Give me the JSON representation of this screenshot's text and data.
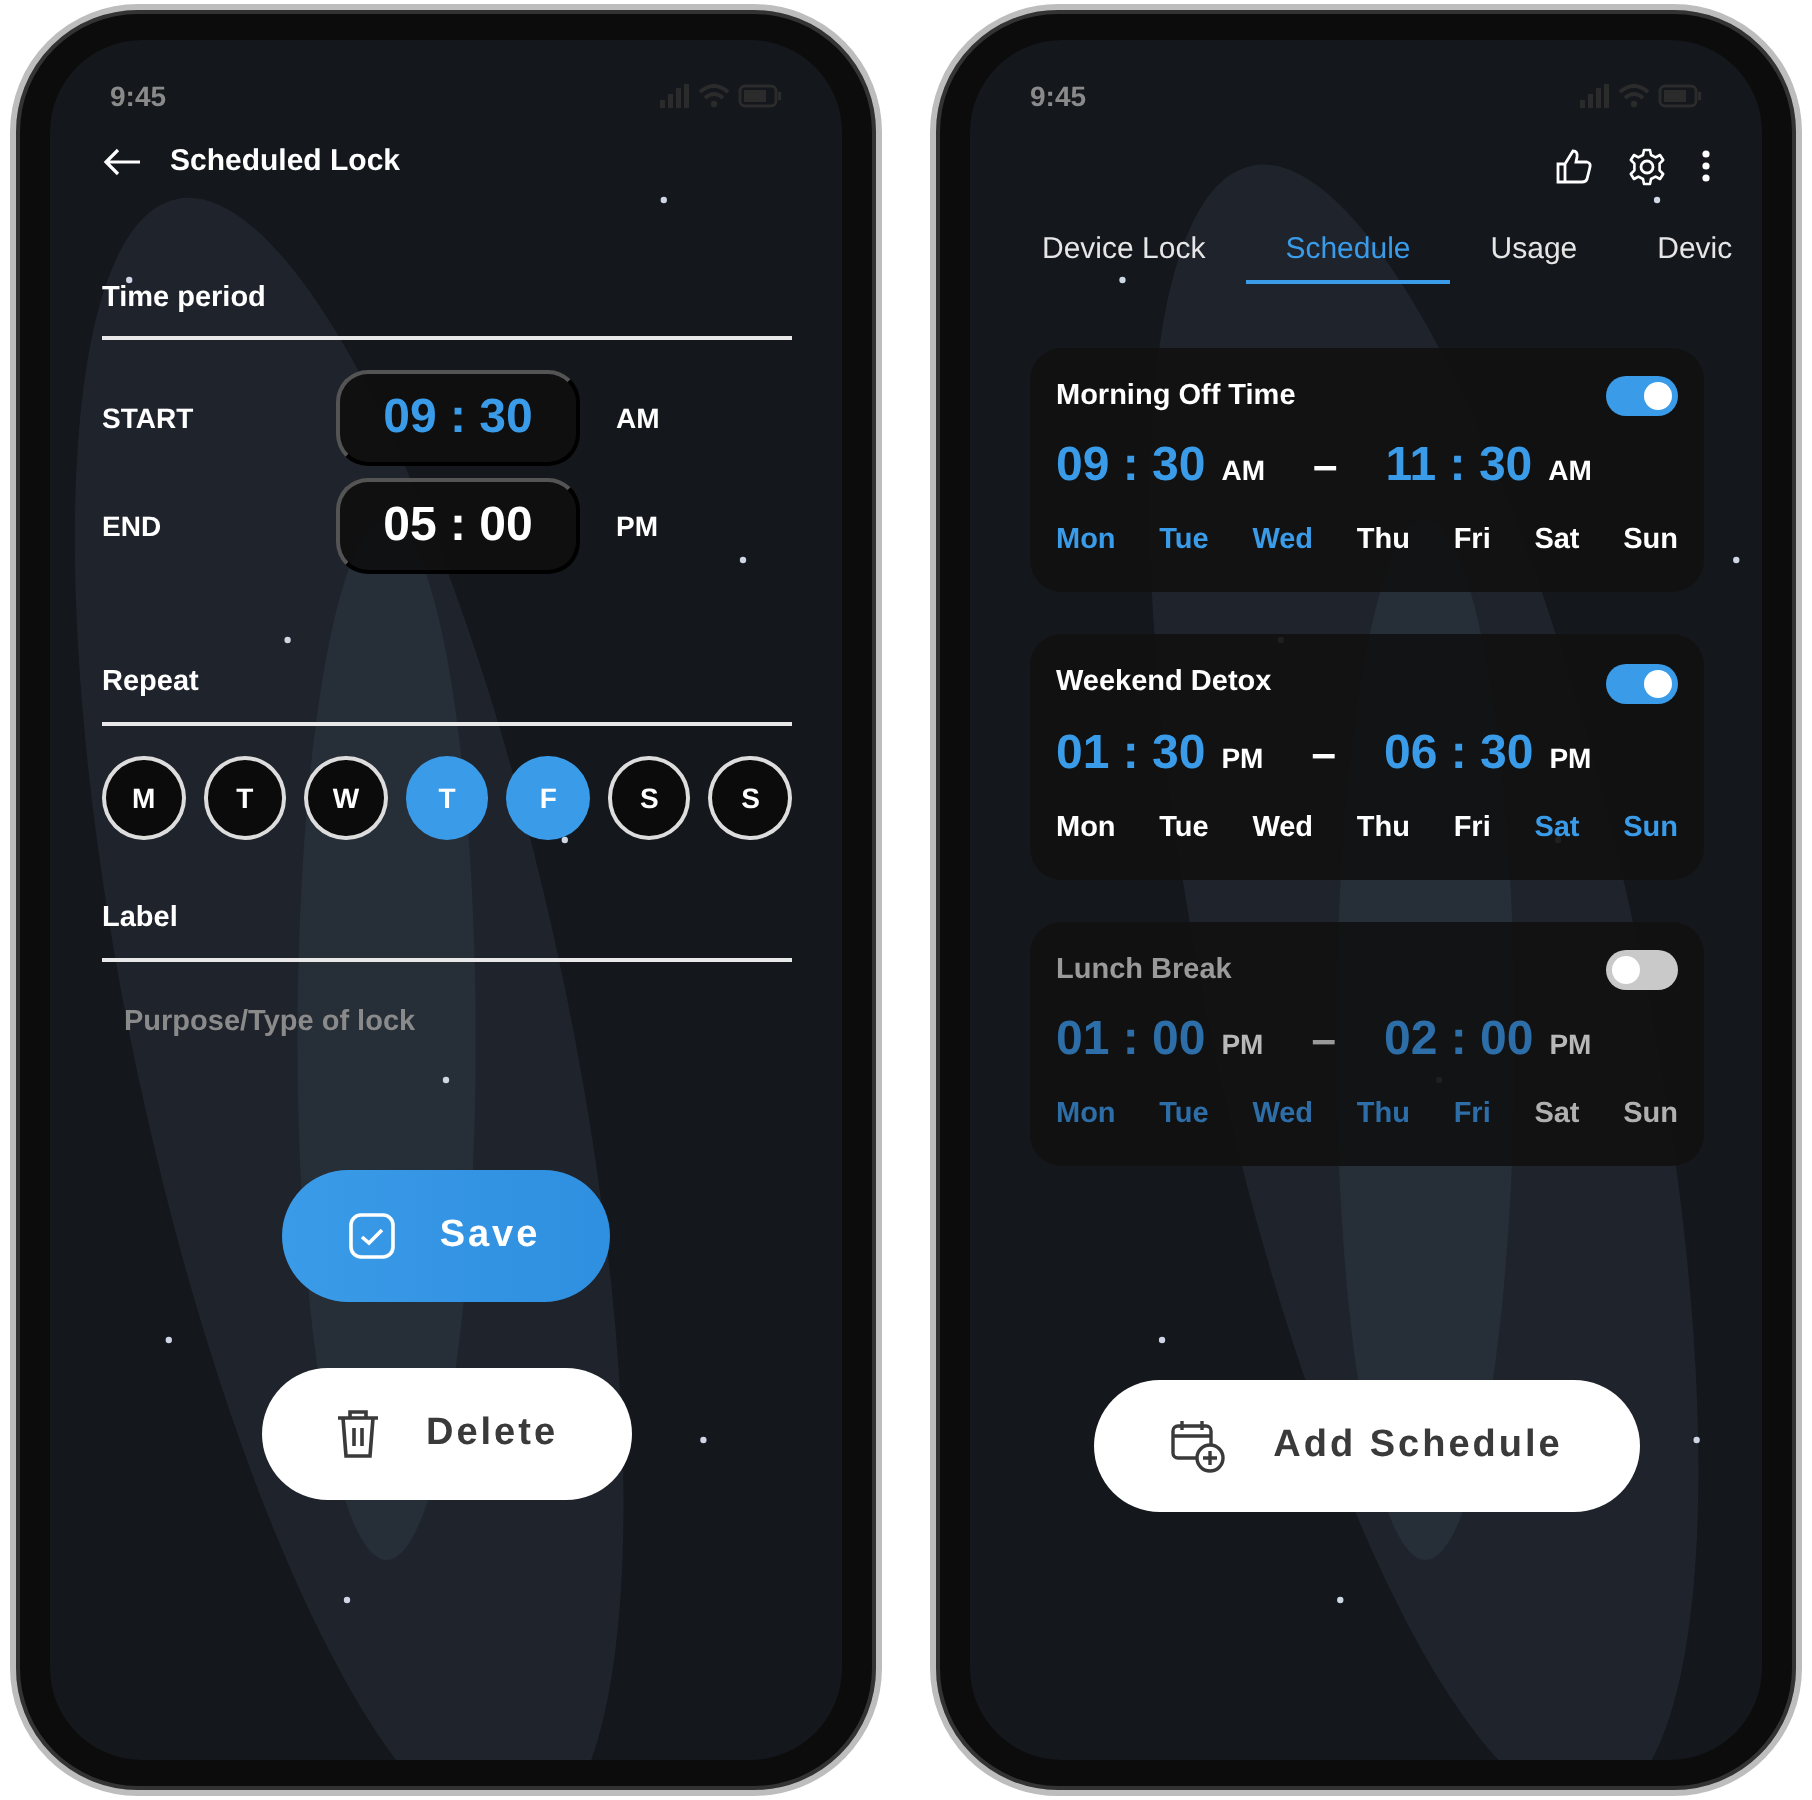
{
  "edit_screen": {
    "status_time": "9:45",
    "title": "Scheduled Lock",
    "time_period_heading": "Time period",
    "times": [
      {
        "label": "START",
        "time": "09 : 30",
        "period": "AM",
        "active": true
      },
      {
        "label": "END",
        "time": "05 : 00",
        "period": "PM",
        "active": false
      }
    ],
    "repeat_heading": "Repeat",
    "days": [
      {
        "letter": "M",
        "selected": false
      },
      {
        "letter": "T",
        "selected": false
      },
      {
        "letter": "W",
        "selected": false
      },
      {
        "letter": "T",
        "selected": true
      },
      {
        "letter": "F",
        "selected": true
      },
      {
        "letter": "S",
        "selected": false
      },
      {
        "letter": "S",
        "selected": false
      }
    ],
    "label_heading": "Label",
    "label_field": {
      "placeholder": "Purpose/Type of lock"
    },
    "save_button": "Save",
    "delete_button": "Delete"
  },
  "list_screen": {
    "status_time": "9:45",
    "tabs": [
      {
        "label": "Device Lock",
        "selected": false
      },
      {
        "label": "Schedule",
        "selected": true
      },
      {
        "label": "Usage",
        "selected": false
      },
      {
        "label": "Devic",
        "selected": false
      }
    ],
    "schedules": [
      {
        "name": "Morning Off Time",
        "on": true,
        "start": {
          "time": "09 : 30",
          "period": "AM"
        },
        "end": {
          "time": "11 : 30",
          "period": "AM"
        },
        "days": [
          {
            "label": "Mon",
            "selected": true
          },
          {
            "label": "Tue",
            "selected": true
          },
          {
            "label": "Wed",
            "selected": true
          },
          {
            "label": "Thu",
            "selected": false
          },
          {
            "label": "Fri",
            "selected": false
          },
          {
            "label": "Sat",
            "selected": false
          },
          {
            "label": "Sun",
            "selected": false
          }
        ]
      },
      {
        "name": "Weekend Detox",
        "on": true,
        "start": {
          "time": "01 : 30",
          "period": "PM"
        },
        "end": {
          "time": "06 : 30",
          "period": "PM"
        },
        "days": [
          {
            "label": "Mon",
            "selected": false
          },
          {
            "label": "Tue",
            "selected": false
          },
          {
            "label": "Wed",
            "selected": false
          },
          {
            "label": "Thu",
            "selected": false
          },
          {
            "label": "Fri",
            "selected": false
          },
          {
            "label": "Sat",
            "selected": true
          },
          {
            "label": "Sun",
            "selected": true
          }
        ]
      },
      {
        "name": "Lunch Break",
        "on": false,
        "start": {
          "time": "01 : 00",
          "period": "PM"
        },
        "end": {
          "time": "02 : 00",
          "period": "PM"
        },
        "days": [
          {
            "label": "Mon",
            "selected": true
          },
          {
            "label": "Tue",
            "selected": true
          },
          {
            "label": "Wed",
            "selected": true
          },
          {
            "label": "Thu",
            "selected": true
          },
          {
            "label": "Fri",
            "selected": true
          },
          {
            "label": "Sat",
            "selected": false
          },
          {
            "label": "Sun",
            "selected": false
          }
        ]
      }
    ],
    "separator": "–",
    "add_button": "Add Schedule"
  }
}
